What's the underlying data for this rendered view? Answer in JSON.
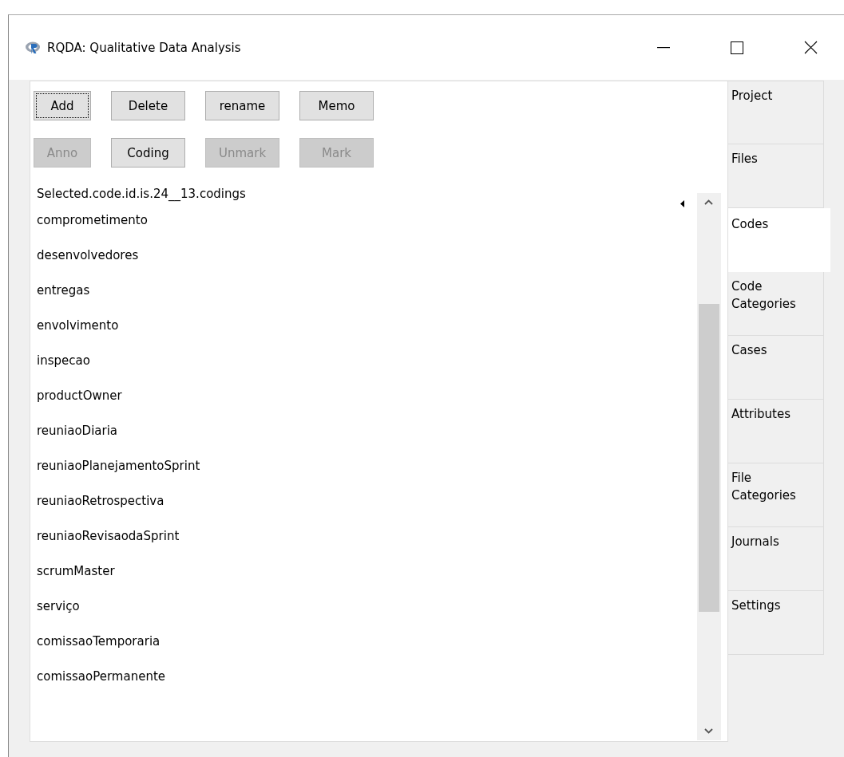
{
  "window": {
    "title": "RQDA: Qualitative Data Analysis"
  },
  "toolbar_rows": [
    [
      {
        "label": "Add",
        "disabled": false,
        "focused": true
      },
      {
        "label": "Delete",
        "disabled": false,
        "focused": false
      },
      {
        "label": "rename",
        "disabled": false,
        "focused": false
      },
      {
        "label": "Memo",
        "disabled": false,
        "focused": false
      }
    ],
    [
      {
        "label": "Anno",
        "disabled": true,
        "focused": false
      },
      {
        "label": "Coding",
        "disabled": false,
        "focused": false
      },
      {
        "label": "Unmark",
        "disabled": true,
        "focused": false
      },
      {
        "label": "Mark",
        "disabled": true,
        "focused": false
      }
    ]
  ],
  "list": {
    "header": "Selected.code.id.is.24__13.codings",
    "items": [
      "comprometimento",
      "desenvolvedores",
      "entregas",
      "envolvimento",
      "inspecao",
      "productOwner",
      "reuniaoDiaria",
      "reuniaoPlanejamentoSprint",
      "reuniaoRetrospectiva",
      "reuniaoRevisaodaSprint",
      "scrumMaster",
      "serviço",
      "comissaoTemporaria",
      "comissaoPermanente"
    ]
  },
  "tabs": [
    {
      "label": "Project",
      "selected": false
    },
    {
      "label": "Files",
      "selected": false
    },
    {
      "label": "Codes",
      "selected": true
    },
    {
      "label": "Code\nCategories",
      "selected": false
    },
    {
      "label": "Cases",
      "selected": false
    },
    {
      "label": "Attributes",
      "selected": false
    },
    {
      "label": "File\nCategories",
      "selected": false
    },
    {
      "label": "Journals",
      "selected": false
    },
    {
      "label": "Settings",
      "selected": false
    }
  ]
}
